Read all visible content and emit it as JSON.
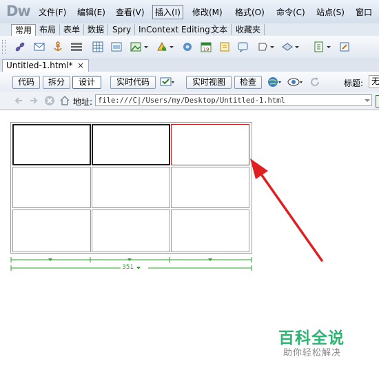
{
  "app": {
    "logo": "Dw"
  },
  "menubar": {
    "items": [
      "文件(F)",
      "编辑(E)",
      "查看(V)",
      "插入(I)",
      "修改(M)",
      "格式(O)",
      "命令(C)",
      "站点(S)",
      "窗口"
    ],
    "active": "插入(I)"
  },
  "insert_tabs": [
    "常用",
    "布局",
    "表单",
    "数据",
    "Spry",
    "InContext Editing",
    "文本",
    "收藏夹"
  ],
  "insert_icons": [
    "hyperlink-icon",
    "email-link-icon",
    "named-anchor-icon",
    "horizontal-rule-icon",
    "table-icon",
    "insert-div-icon",
    "image-icon",
    "media-icon",
    "server-include-icon",
    "date-icon",
    "comment-icon",
    "head-tags-icon",
    "script-icon",
    "templates-icon",
    "tag-chooser-icon"
  ],
  "document": {
    "tab_title": "Untitled-1.html*",
    "close_symbol": "×"
  },
  "doc_toolbar": {
    "code": "代码",
    "split": "拆分",
    "design": "设计",
    "live_code": "实时代码",
    "live_view": "实时视图",
    "inspect": "检查",
    "title_label": "标题:",
    "title_value": "无"
  },
  "address_bar": {
    "label": "地址:",
    "value": "file:///C|/Users/my/Desktop/Untitled-1.html"
  },
  "table": {
    "rows": 3,
    "cols": 3,
    "width_label": "351"
  },
  "annotation": {
    "arrow_color": "#e02020"
  },
  "watermark": {
    "title": "百科全说",
    "subtitle": "助你轻松解决",
    "color": "#2bb673"
  }
}
